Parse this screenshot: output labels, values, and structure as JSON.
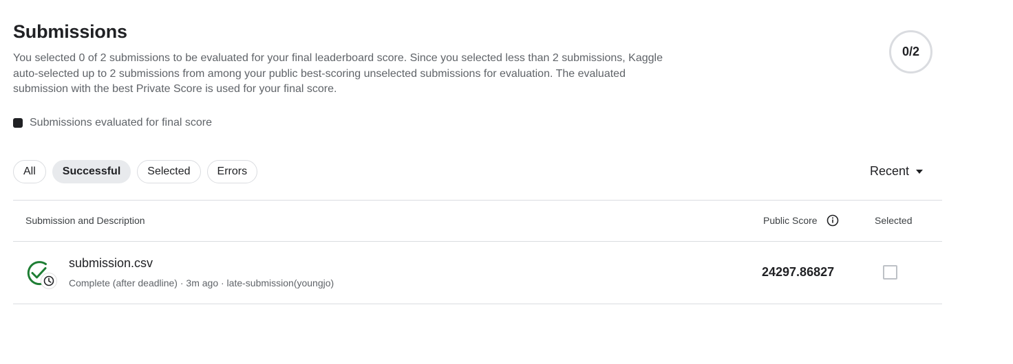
{
  "header": {
    "title": "Submissions",
    "description": "You selected 0 of 2 submissions to be evaluated for your final leaderboard score. Since you selected less than 2 submissions, Kaggle auto-selected up to 2 submissions from among your public best-scoring unselected submissions for evaluation. The evaluated submission with the best Private Score is used for your final score.",
    "counter": "0/2"
  },
  "legend": {
    "label": "Submissions evaluated for final score"
  },
  "filters": {
    "all": "All",
    "successful": "Successful",
    "selected": "Selected",
    "errors": "Errors",
    "active": "Successful"
  },
  "sort": {
    "label": "Recent"
  },
  "table": {
    "columns": {
      "submission": "Submission and Description",
      "public_score": "Public Score",
      "selected": "Selected"
    },
    "rows": [
      {
        "filename": "submission.csv",
        "meta": "Complete (after deadline) · 3m ago · late-submission(youngjo)",
        "public_score": "24297.86827",
        "selected": false,
        "status_icon": "check-clock-icon"
      }
    ]
  },
  "colors": {
    "success_green": "#1e7e34",
    "border": "#dadce0",
    "text_primary": "#202124",
    "text_secondary": "#5f6368"
  }
}
